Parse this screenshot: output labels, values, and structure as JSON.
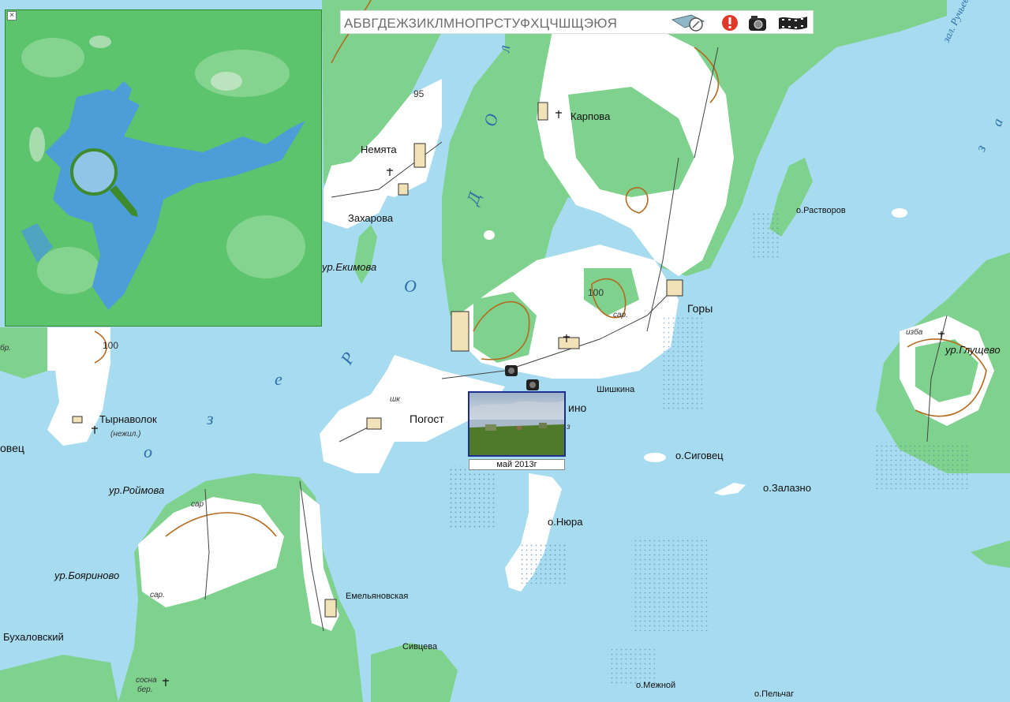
{
  "toolbar": {
    "alphabet": "АБВГДЕЖЗИКЛМНОПРСТУФХЦЧШЩЭЮЯ",
    "icons": [
      "compass-icon",
      "alert-icon",
      "camera-icon",
      "film-icon"
    ]
  },
  "overview": {
    "close": "×"
  },
  "photo": {
    "caption": "май 2013г"
  },
  "labels": {
    "nemyata": "Немята",
    "zakharova": "Захарова",
    "ekimova": "ур.Екимова",
    "karpova": "Карпова",
    "gory": "Горы",
    "shishkina": "Шишкина",
    "pogost": "Погост",
    "ino": "ино",
    "rastvorov": "о.Растворов",
    "glushchevo": "ур.Глущево",
    "izba": "изба",
    "sigovets": "о.Сиговец",
    "zalazno": "о.Залазно",
    "nyura": "о.Нюра",
    "tyrnavolok": "Тырнаволок",
    "nezhil": "(нежил.)",
    "ovets": "овец",
    "roimova": "ур.Роймова",
    "boyarinovo": "ур.Бояриново",
    "emelyanovskaya": "Емельяновская",
    "bukhalovsky": "Бухаловский",
    "sivtseva": "Сивцева",
    "mezhnoy": "о.Межной",
    "pelchag": "о.Пельчаг",
    "rucheyvsky": "зал. Ручьевск",
    "sosna": "сосна",
    "ber": "бер.",
    "sar": "сар",
    "sar2": "сар.",
    "br": "бр.",
    "sh": "шк",
    "three": "з"
  },
  "contours": {
    "c95": "95",
    "c100a": "100",
    "c100b": "100"
  },
  "lake_letters": {
    "o1": "О",
    "d": "Д",
    "o2": "О",
    "r": "Р",
    "o3": "О",
    "e": "е",
    "z": "з",
    "o4": "о",
    "l": "л",
    "z2": "з",
    "a": "а"
  },
  "colors": {
    "water": "#a7dbf0",
    "forest": "#7fd28e",
    "open": "#ffffff",
    "contour": "#b46a1e",
    "overview_frame": "#2f8a2f"
  }
}
